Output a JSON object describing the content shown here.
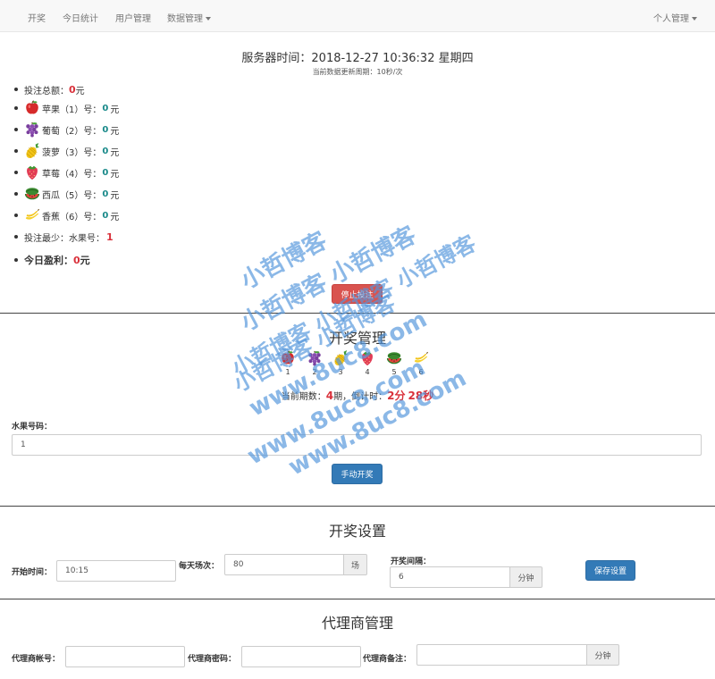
{
  "navbar": {
    "items": [
      "开奖",
      "今日统计",
      "用户管理",
      "数据管理"
    ],
    "user_menu": "个人管理"
  },
  "header": {
    "server_time_label": "服务器时间：",
    "server_time_value": "2018-12-27  10:36:32  星期四",
    "refresh_note": "当前数据更新周期：10秒/次"
  },
  "stats": {
    "total_label": "投注总额：",
    "total_value": "0",
    "total_unit": "元",
    "fruits": [
      {
        "icon": "apple-icon",
        "label": "苹果（1）号：",
        "value": "0",
        "unit": "元"
      },
      {
        "icon": "grape-icon",
        "label": "葡萄（2）号：",
        "value": "0",
        "unit": "元"
      },
      {
        "icon": "pineapple-icon",
        "label": "菠萝（3）号：",
        "value": "0",
        "unit": "元"
      },
      {
        "icon": "strawberry-icon",
        "label": "草莓（4）号：",
        "value": "0",
        "unit": "元"
      },
      {
        "icon": "watermelon-icon",
        "label": "西瓜（5）号：",
        "value": "0",
        "unit": "元"
      },
      {
        "icon": "banana-icon",
        "label": "香蕉（6）号：",
        "value": "0",
        "unit": "元"
      }
    ],
    "least_label": "投注最少：水果号：",
    "least_value": "1",
    "profit_label": "今日盈利：",
    "profit_value": "0",
    "profit_unit": "元"
  },
  "stop_button": "停止投注",
  "draw": {
    "title": "开奖管理",
    "numbers": [
      "1",
      "2",
      "3",
      "4",
      "5",
      "6"
    ],
    "period_label": "当前期数：",
    "period_value": "4",
    "period_suffix": "期，倒计时：",
    "countdown_min": "2",
    "countdown_min_unit": "分",
    "countdown_sec": "28",
    "countdown_sec_unit": "秒",
    "fruit_number_label": "水果号码：",
    "fruit_number_value": "1",
    "manual_button": "手动开奖"
  },
  "settings": {
    "title": "开奖设置",
    "start_time_label": "开始时间：",
    "start_time_value": "10:15",
    "daily_rounds_label": "每天场次：",
    "daily_rounds_value": "80",
    "daily_rounds_unit": "场",
    "interval_label": "开奖间隔：",
    "interval_value": "6",
    "interval_unit": "分钟",
    "save_button": "保存设置"
  },
  "agents": {
    "title": "代理商管理",
    "account_label": "代理商帐号：",
    "password_label": "代理商密码：",
    "note_label": "代理商备注：",
    "unit": "分钟"
  },
  "watermark": {
    "lines": [
      "小哲博客",
      "小哲博客 小哲博客",
      "小哲博客 小哲博客 小哲博客",
      "小哲博客 小哲博客",
      "www.8uc8.com",
      "www.8uc8.com",
      "www.8uc8.com"
    ]
  },
  "colors": {
    "nav_bg": "#f8f8f8",
    "accent_red": "#d9303a",
    "teal": "#1a8a8a",
    "primary": "#337ab7",
    "danger": "#d9534f"
  }
}
